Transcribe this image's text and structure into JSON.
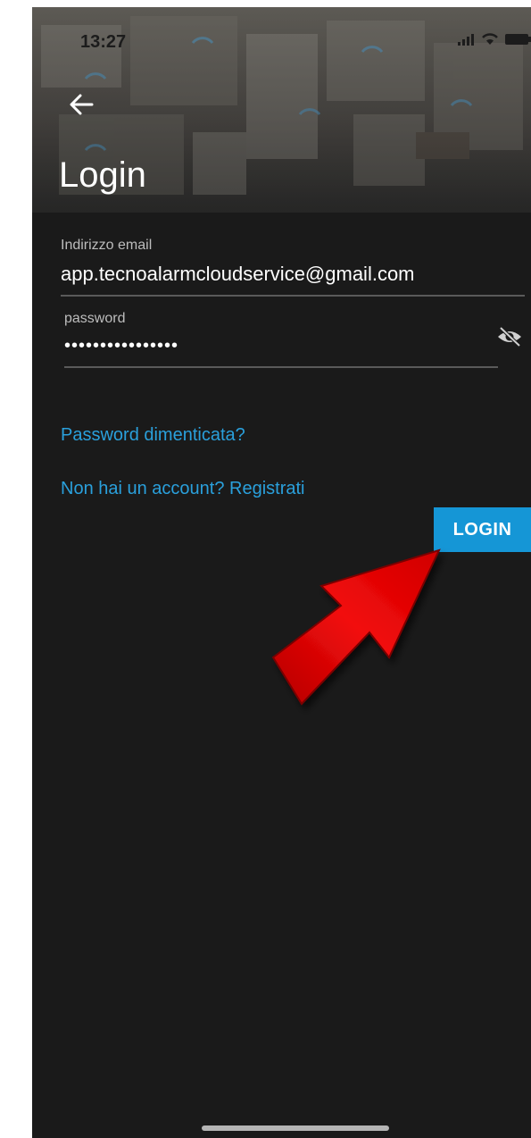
{
  "status_bar": {
    "time": "13:27"
  },
  "header": {
    "title": "Login"
  },
  "form": {
    "email": {
      "label": "Indirizzo email",
      "value": "app.tecnoalarmcloudservice@gmail.com"
    },
    "password": {
      "label": "password",
      "value": "••••••••••••••••"
    }
  },
  "links": {
    "forgot_password": "Password dimenticata?",
    "register": "Non hai un account? Registrati"
  },
  "login_button": {
    "label": "LOGIN"
  },
  "icons": {
    "back": "arrow-left-icon",
    "visibility": "eye-off-icon",
    "signal": "signal-icon",
    "wifi": "wifi-icon",
    "battery": "battery-icon",
    "pointer": "red-arrow-icon"
  },
  "colors": {
    "background": "#1a1a1a",
    "accent": "#1596d6",
    "link": "#2aa0dc",
    "pointer": "#e00000"
  }
}
